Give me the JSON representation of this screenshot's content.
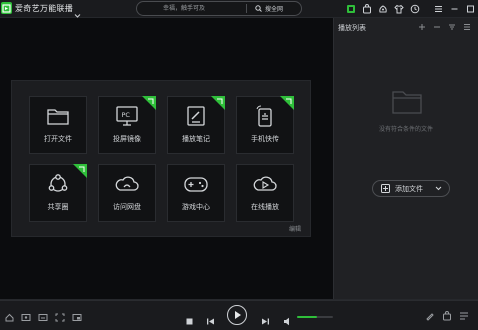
{
  "app": {
    "title": "爱奇艺万能联播",
    "accent": "#2fbf3a"
  },
  "search": {
    "placeholder": "幸福，触手可及",
    "button_label": "搜全网"
  },
  "toolbar_icons": [
    "screen-record-icon",
    "bag-icon",
    "skin-icon",
    "shirt-icon",
    "clock-icon"
  ],
  "window_controls": [
    "menu-icon",
    "minimize-icon",
    "maximize-icon",
    "close-icon"
  ],
  "tiles": [
    {
      "label": "打开文件",
      "icon": "folder-icon",
      "badge": false
    },
    {
      "label": "投屏镜像",
      "icon": "pc-screen-icon",
      "badge": true
    },
    {
      "label": "播放笔记",
      "icon": "note-icon",
      "badge": true
    },
    {
      "label": "手机快传",
      "icon": "phone-transfer-icon",
      "badge": true
    },
    {
      "label": "共享圈",
      "icon": "share-circle-icon",
      "badge": true
    },
    {
      "label": "访问网盘",
      "icon": "cloud-icon",
      "badge": false
    },
    {
      "label": "游戏中心",
      "icon": "gamepad-icon",
      "badge": false
    },
    {
      "label": "在线播放",
      "icon": "online-play-icon",
      "badge": false
    }
  ],
  "panel": {
    "edit_label": "编辑"
  },
  "playlist": {
    "title": "播放列表",
    "empty_text": "没有符合条件的文件",
    "add_label": "添加文件"
  },
  "player": {
    "volume": 0.55
  }
}
